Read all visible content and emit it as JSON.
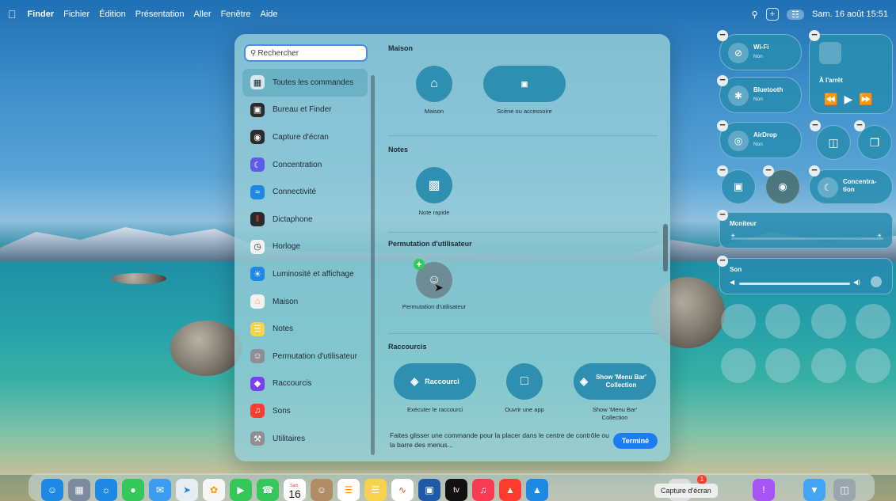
{
  "menubar": {
    "apple_icon": "apple-icon",
    "app": "Finder",
    "items": [
      "Fichier",
      "Édition",
      "Présentation",
      "Aller",
      "Fenêtre",
      "Aide"
    ],
    "plus": "+",
    "datetime": "Sam. 16 août 15:51"
  },
  "search": {
    "placeholder": "Rechercher"
  },
  "sidebar": {
    "items": [
      {
        "label": "Toutes les commandes",
        "icon": "grid-icon",
        "color": "#d9e8ec"
      },
      {
        "label": "Bureau et Finder",
        "icon": "finder-icon",
        "color": "#2b2b2b"
      },
      {
        "label": "Capture d'écran",
        "icon": "screenshot-icon",
        "color": "#2b2b2b"
      },
      {
        "label": "Concentration",
        "icon": "moon-icon",
        "color": "#5e5ce6"
      },
      {
        "label": "Connectivité",
        "icon": "wifi-icon",
        "color": "#1e88e5"
      },
      {
        "label": "Dictaphone",
        "icon": "waveform-icon",
        "color": "#2b2b2b"
      },
      {
        "label": "Horloge",
        "icon": "clock-icon",
        "color": "#f2f2f2"
      },
      {
        "label": "Luminosité et affichage",
        "icon": "sun-icon",
        "color": "#1e88e5"
      },
      {
        "label": "Maison",
        "icon": "home-icon",
        "color": "#f2f2f2"
      },
      {
        "label": "Notes",
        "icon": "notes-icon",
        "color": "#f6d34a"
      },
      {
        "label": "Permutation d'utilisateur",
        "icon": "user-switch-icon",
        "color": "#8e8e93"
      },
      {
        "label": "Raccourcis",
        "icon": "shortcuts-icon",
        "color": "#7a3ff2"
      },
      {
        "label": "Sons",
        "icon": "speaker-icon",
        "color": "#ff3b30"
      },
      {
        "label": "Utilitaires",
        "icon": "tools-icon",
        "color": "#8e8e93"
      }
    ]
  },
  "sections": {
    "maison": {
      "title": "Maison",
      "items": [
        {
          "label": "Maison",
          "icon": "home-icon"
        },
        {
          "label": "Scène ou accessoire",
          "icon": "scene-icon"
        }
      ]
    },
    "notes": {
      "title": "Notes",
      "items": [
        {
          "label": "Note rapide",
          "icon": "quick-note-icon"
        }
      ]
    },
    "permutation": {
      "title": "Permutation d'utilisateur",
      "items": [
        {
          "label": "Permutation d'utilisateur",
          "icon": "user-switch-icon"
        }
      ]
    },
    "raccourcis": {
      "title": "Raccourcis",
      "items": [
        {
          "label": "Exécuter le raccourci",
          "pill": "Raccourci",
          "icon": "layers-icon"
        },
        {
          "label": "Ouvrir une app",
          "icon": "app-frame-icon"
        },
        {
          "label": "Show 'Menu Bar' Collection",
          "pill": "Show 'Menu Bar' Collection",
          "icon": "layers-icon"
        }
      ]
    }
  },
  "footer": {
    "hint": "Faites glisser une commande pour la placer dans le centre de contrôle ou la barre des menus...",
    "done": "Terminé"
  },
  "control_center": {
    "wifi": {
      "name": "Wi-Fi",
      "state": "Non"
    },
    "bluetooth": {
      "name": "Bluetooth",
      "state": "Non"
    },
    "airdrop": {
      "name": "AirDrop",
      "state": "Non"
    },
    "now_playing": "À l'arrêt",
    "focus": "Concentra-\ntion",
    "moniteur": "Moniteur",
    "son": "Son"
  },
  "dock": {
    "tooltip": "Capture d'écran",
    "calendar_day": "16",
    "calendar_month": "Sam.",
    "tv": "tv",
    "badge": "1"
  }
}
